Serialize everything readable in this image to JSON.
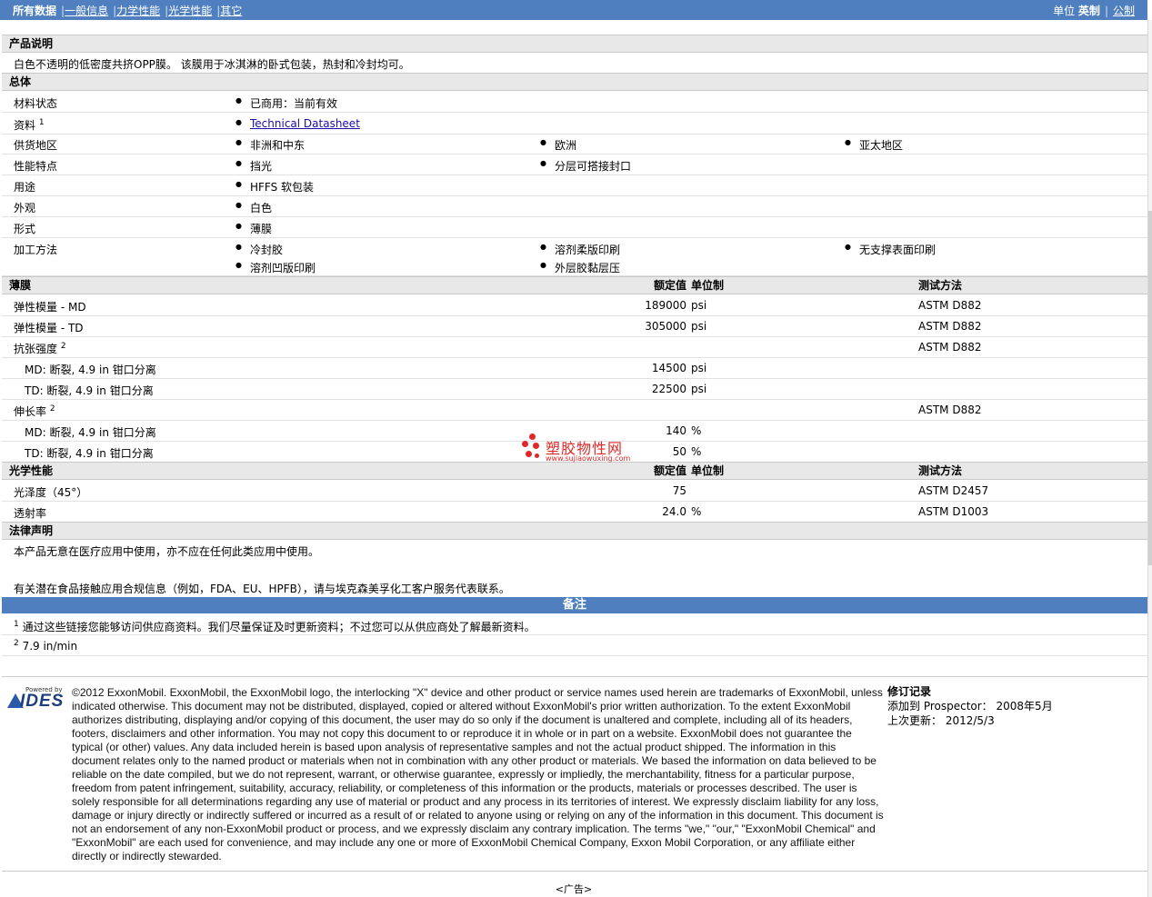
{
  "nav": {
    "tabs": [
      "所有数据",
      "一般信息",
      "力学性能",
      "光学性能",
      "其它"
    ],
    "units_label": "单位",
    "unit_english": "英制",
    "unit_metric": "公制"
  },
  "sections": {
    "desc_title": "产品说明",
    "desc_text": "白色不透明的低密度共挤OPP膜。 该膜用于冰淇淋的卧式包装，热封和冷封均可。",
    "general_title": "总体",
    "film_title": "薄膜",
    "optical_title": "光学性能",
    "legal_title": "法律声明",
    "col_value": "额定值",
    "col_unit": "单位制",
    "col_method": "测试方法"
  },
  "general": {
    "status_label": "材料状态",
    "status_value": "已商用：当前有效",
    "docs_label": "资料",
    "docs_sup": "1",
    "docs_link": "Technical Datasheet",
    "regions_label": "供货地区",
    "regions": [
      "非洲和中东",
      "欧洲",
      "亚太地区"
    ],
    "features_label": "性能特点",
    "features": [
      "挡光",
      "分层可搭接封口"
    ],
    "uses_label": "用途",
    "uses": [
      "HFFS 软包装"
    ],
    "appearance_label": "外观",
    "appearance": [
      "白色"
    ],
    "form_label": "形式",
    "form": [
      "薄膜"
    ],
    "process_label": "加工方法",
    "process": [
      "冷封胶",
      "溶剂柔版印刷",
      "无支撑表面印刷",
      "溶剂凹版印刷",
      "外层胶黏层压"
    ]
  },
  "film": {
    "rows": [
      {
        "label": "弹性模量 - MD",
        "value": "189000",
        "unit": "psi",
        "method": "ASTM D882"
      },
      {
        "label": "弹性模量 - TD",
        "value": "305000",
        "unit": "psi",
        "method": "ASTM D882"
      }
    ],
    "tensile_label": "抗张强度",
    "tensile_sup": "2",
    "tensile_method": "ASTM D882",
    "tensile_rows": [
      {
        "label": "MD: 断裂, 4.9 in 钳口分离",
        "value": "14500",
        "unit": "psi"
      },
      {
        "label": "TD: 断裂, 4.9 in 钳口分离",
        "value": "22500",
        "unit": "psi"
      }
    ],
    "elong_label": "伸长率",
    "elong_sup": "2",
    "elong_method": "ASTM D882",
    "elong_rows": [
      {
        "label": "MD: 断裂, 4.9 in 钳口分离",
        "value": "140",
        "unit": "%"
      },
      {
        "label": "TD: 断裂, 4.9 in 钳口分离",
        "value": "50",
        "unit": "%"
      }
    ]
  },
  "optical": {
    "rows": [
      {
        "label": "光泽度（45°）",
        "value": "75",
        "unit": "",
        "method": "ASTM D2457"
      },
      {
        "label": "透射率",
        "value": "24.0",
        "unit": "%",
        "method": "ASTM D1003"
      }
    ]
  },
  "legal": {
    "line1": "本产品无意在医疗应用中使用，亦不应在任何此类应用中使用。",
    "line2": "有关潜在食品接触应用合规信息（例如，FDA、EU、HPFB），请与埃克森美孚化工客户服务代表联系。"
  },
  "notes": {
    "title": "备注",
    "n1_sup": "1",
    "n1": "通过这些链接您能够访问供应商资料。我们尽量保证及时更新资料；不过您可以从供应商处了解最新资料。",
    "n2_sup": "2",
    "n2": "7.9 in/min"
  },
  "footer": {
    "logo_powered": "Powered by",
    "logo_name": "IDES",
    "copyright": "©2012 ExxonMobil. ExxonMobil, the ExxonMobil logo, the interlocking \"X\" device and other product or service names used herein are trademarks of ExxonMobil, unless indicated otherwise. This document may not be distributed, displayed, copied or altered without ExxonMobil's prior written authorization. To the extent ExxonMobil authorizes distributing, displaying and/or copying of this document, the user may do so only if the document is unaltered and complete, including all of its headers, footers, disclaimers and other information. You may not copy this document to or reproduce it in whole or in part on a website. ExxonMobil does not guarantee the typical (or other) values. Any data included herein is based upon analysis of representative samples and not the actual product shipped. The information in this document relates only to the named product or materials when not in combination with any other product or materials. We based the information on data believed to be reliable on the date compiled, but we do not represent, warrant, or otherwise guarantee, expressly or impliedly, the merchantability, fitness for a particular purpose, freedom from patent infringement, suitability, accuracy, reliability, or completeness of this information or the products, materials or processes described. The user is solely responsible for all determinations regarding any use of material or product and any process in its territories of interest. We expressly disclaim liability for any loss, damage or injury directly or indirectly suffered or incurred as a result of or related to anyone using or relying on any of the information in this document. This document is not an endorsement of any non-ExxonMobil product or process, and we expressly disclaim any contrary implication. The terms \"we,\" \"our,\" \"ExxonMobil Chemical\" and \"ExxonMobil\" are each used for convenience, and may include any one or more of ExxonMobil Chemical Company, Exxon Mobil Corporation, or any affiliate either directly or indirectly stewarded.",
    "rev_title": "修订记录",
    "rev_added_label": "添加到 Prospector：",
    "rev_added": "2008年5月",
    "rev_updated_label": "上次更新：",
    "rev_updated": "2012/5/3",
    "ad": "<广告>"
  },
  "watermark": {
    "cn": "塑胶物性网",
    "url": "www.sujiaowuxing.com"
  }
}
